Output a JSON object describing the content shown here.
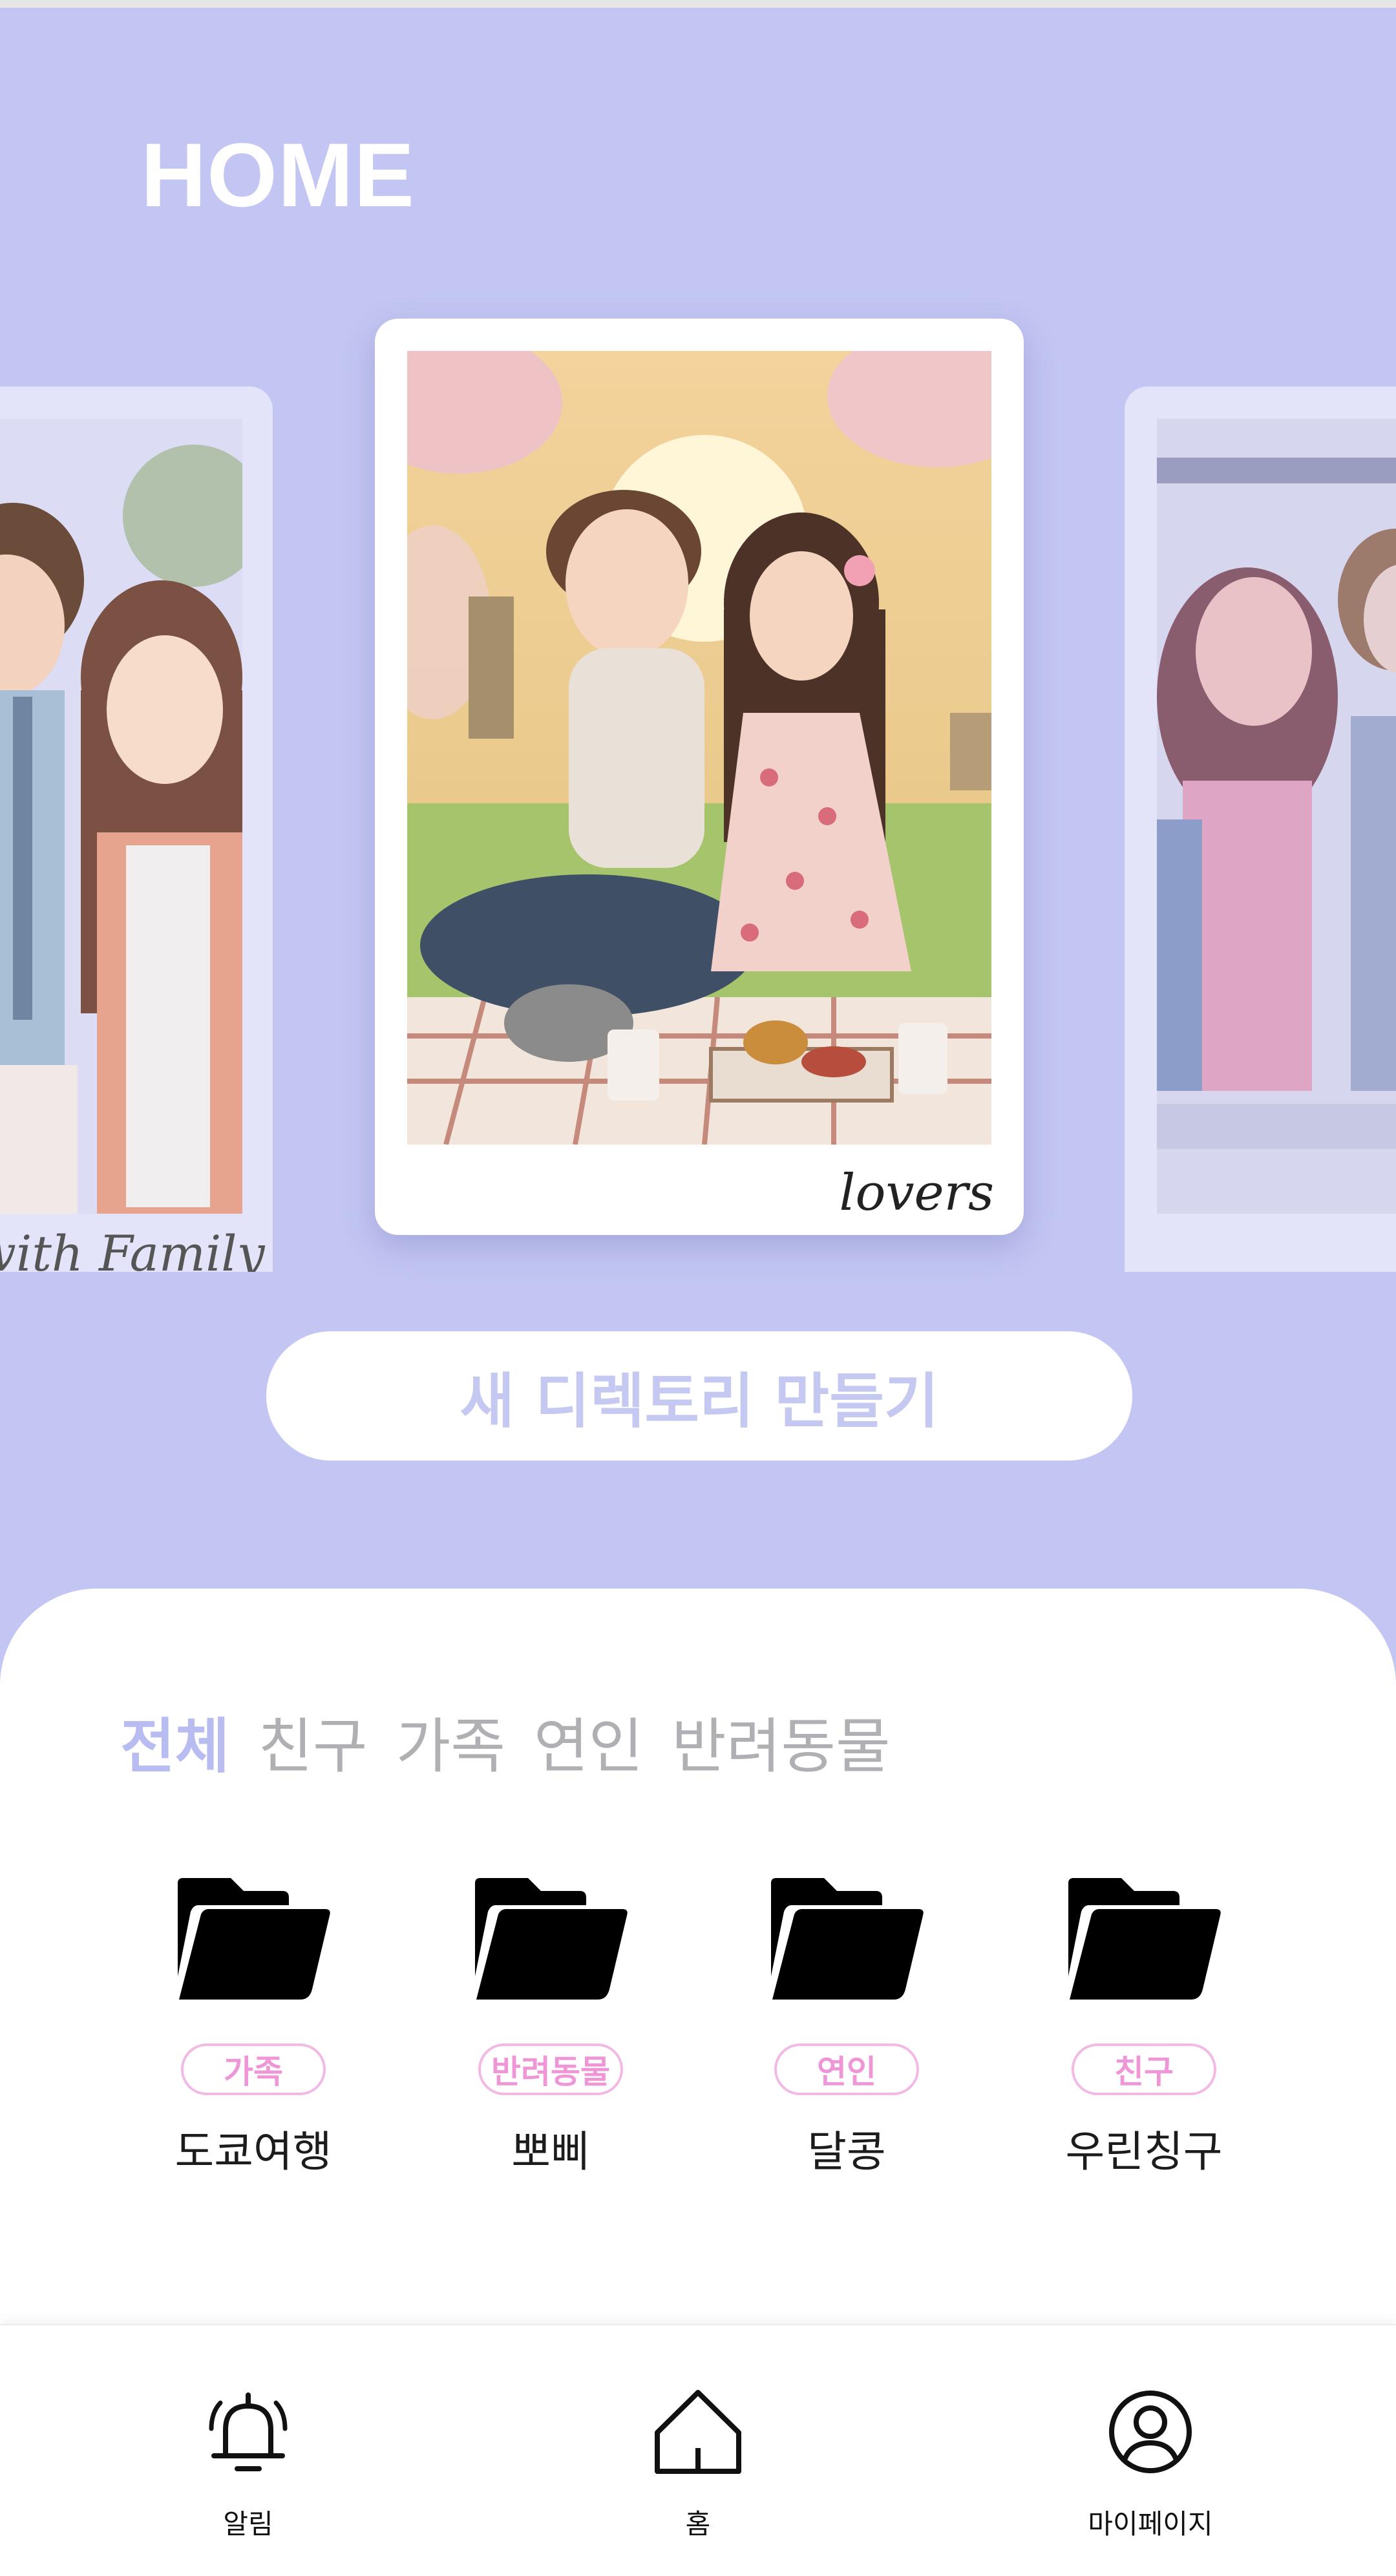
{
  "header": {
    "title": "HOME"
  },
  "carousel": {
    "cards": [
      {
        "caption": "with Family",
        "scene": "family"
      },
      {
        "caption": "lovers",
        "scene": "couple-picnic"
      },
      {
        "caption": "",
        "scene": "friends"
      }
    ]
  },
  "actions": {
    "new_directory": "새 디렉토리 만들기"
  },
  "filters": {
    "tabs": [
      "전체",
      "친구",
      "가족",
      "연인",
      "반려동물"
    ],
    "active": "전체"
  },
  "folders": [
    {
      "tag": "가족",
      "name": "도쿄여행",
      "icon": "folder-icon"
    },
    {
      "tag": "반려동물",
      "name": "뽀삐",
      "icon": "folder-icon"
    },
    {
      "tag": "연인",
      "name": "달콩",
      "icon": "folder-icon"
    },
    {
      "tag": "친구",
      "name": "우린칭구",
      "icon": "folder-icon"
    }
  ],
  "nav": {
    "items": [
      {
        "label": "알림",
        "icon": "bell-icon"
      },
      {
        "label": "홈",
        "icon": "home-icon"
      },
      {
        "label": "마이페이지",
        "icon": "profile-icon"
      }
    ]
  },
  "colors": {
    "background": "#c3c6f2",
    "accent": "#b8bcf0",
    "tag_pink": "#ef97d6"
  }
}
